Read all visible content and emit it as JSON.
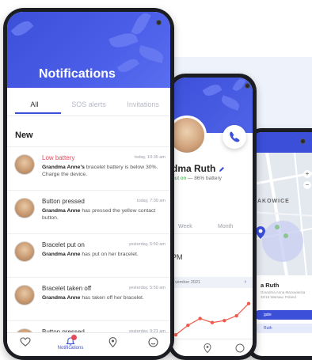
{
  "phone1": {
    "title": "Notifications",
    "tabs": [
      {
        "label": "All",
        "active": true
      },
      {
        "label": "SOS alerts",
        "active": false
      },
      {
        "label": "Invitations",
        "active": false
      }
    ],
    "section_label": "New",
    "notifications": [
      {
        "title": "Low battery",
        "alert": true,
        "time": "today, 10:35 am",
        "sender": "Grandma Anne's",
        "body": "bracelet battery is below 30%. Charge the device."
      },
      {
        "title": "Button pressed",
        "alert": false,
        "time": "today, 7:30 am",
        "sender": "Grandma Anne",
        "body": "has pressed the yellow contact button."
      },
      {
        "title": "Bracelet put on",
        "alert": false,
        "time": "yesterday, 5:50 am",
        "sender": "Grandma Anne",
        "body": "has put on her bracelet."
      },
      {
        "title": "Bracelet taken off",
        "alert": false,
        "time": "yesterday, 5:50 am",
        "sender": "Grandma Anne",
        "body": "has taken off her bracelet."
      },
      {
        "title": "Button pressed",
        "alert": false,
        "time": "yesterday, 9:21 am",
        "sender": "",
        "body": ""
      }
    ],
    "nav": [
      {
        "label": "",
        "icon": "heart-icon"
      },
      {
        "label": "Notifications",
        "icon": "bell-icon",
        "active": true
      },
      {
        "label": "",
        "icon": "location-pin-icon"
      },
      {
        "label": "",
        "icon": "profile-icon"
      }
    ]
  },
  "phone2": {
    "name": "dma Ruth",
    "status": "put on",
    "battery": "— 86% battery",
    "periods": [
      "Week",
      "Month"
    ],
    "time_reading": "PM",
    "date_range": "vember 2021",
    "chart_points": [
      62,
      48,
      38,
      44,
      41,
      34,
      16
    ]
  },
  "phone3": {
    "map_label": "AKOWICE",
    "card_name": "a Ruth",
    "card_address": "Grandma Anna Mazowiecka 32/15 Warsaw, Poland",
    "button_primary": "gate",
    "button_secondary": "Ruth"
  },
  "colors": {
    "brand": "#3b4fd9",
    "alert": "#e24b5c",
    "chart_line": "#f05a4a",
    "ok": "#3ea34a"
  }
}
